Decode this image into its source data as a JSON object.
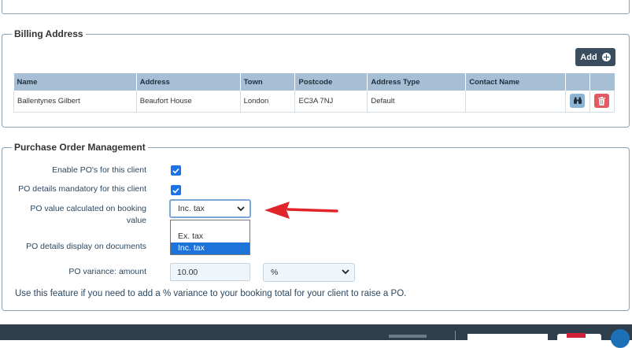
{
  "billing": {
    "legend": "Billing Address",
    "add_label": "Add",
    "columns": [
      "Name",
      "Address",
      "Town",
      "Postcode",
      "Address Type",
      "Contact Name",
      "",
      ""
    ],
    "rows": [
      [
        "Ballentynes Gilbert",
        "Beaufort House",
        "London",
        "EC3A 7NJ",
        "Default",
        ""
      ]
    ]
  },
  "po": {
    "legend": "Purchase Order Management",
    "enable_label": "Enable PO's for this client",
    "enable_checked": true,
    "mandatory_label": "PO details mandatory for this client",
    "mandatory_checked": true,
    "value_label": "PO value calculated on booking value",
    "value_selected": "Inc. tax",
    "value_options": [
      "Ex. tax",
      "Inc. tax"
    ],
    "display_label": "PO details display on documents",
    "variance_label": "PO variance: amount",
    "variance_value": "10.00",
    "variance_unit": "%",
    "help_text": "Use this feature if you need to add a % variance to your booking total for your client to raise a PO."
  },
  "colors": {
    "accent": "#1e73d8",
    "header_bg": "#a6bfd4",
    "add_button": "#3a4d5e",
    "delete_button": "#e55a62",
    "annotation_arrow": "#e0242a"
  },
  "icons": [
    "plus-circle-icon",
    "binoculars-icon",
    "trash-icon",
    "checkmark-icon",
    "chevron-down-icon",
    "red-arrow-annotation"
  ]
}
